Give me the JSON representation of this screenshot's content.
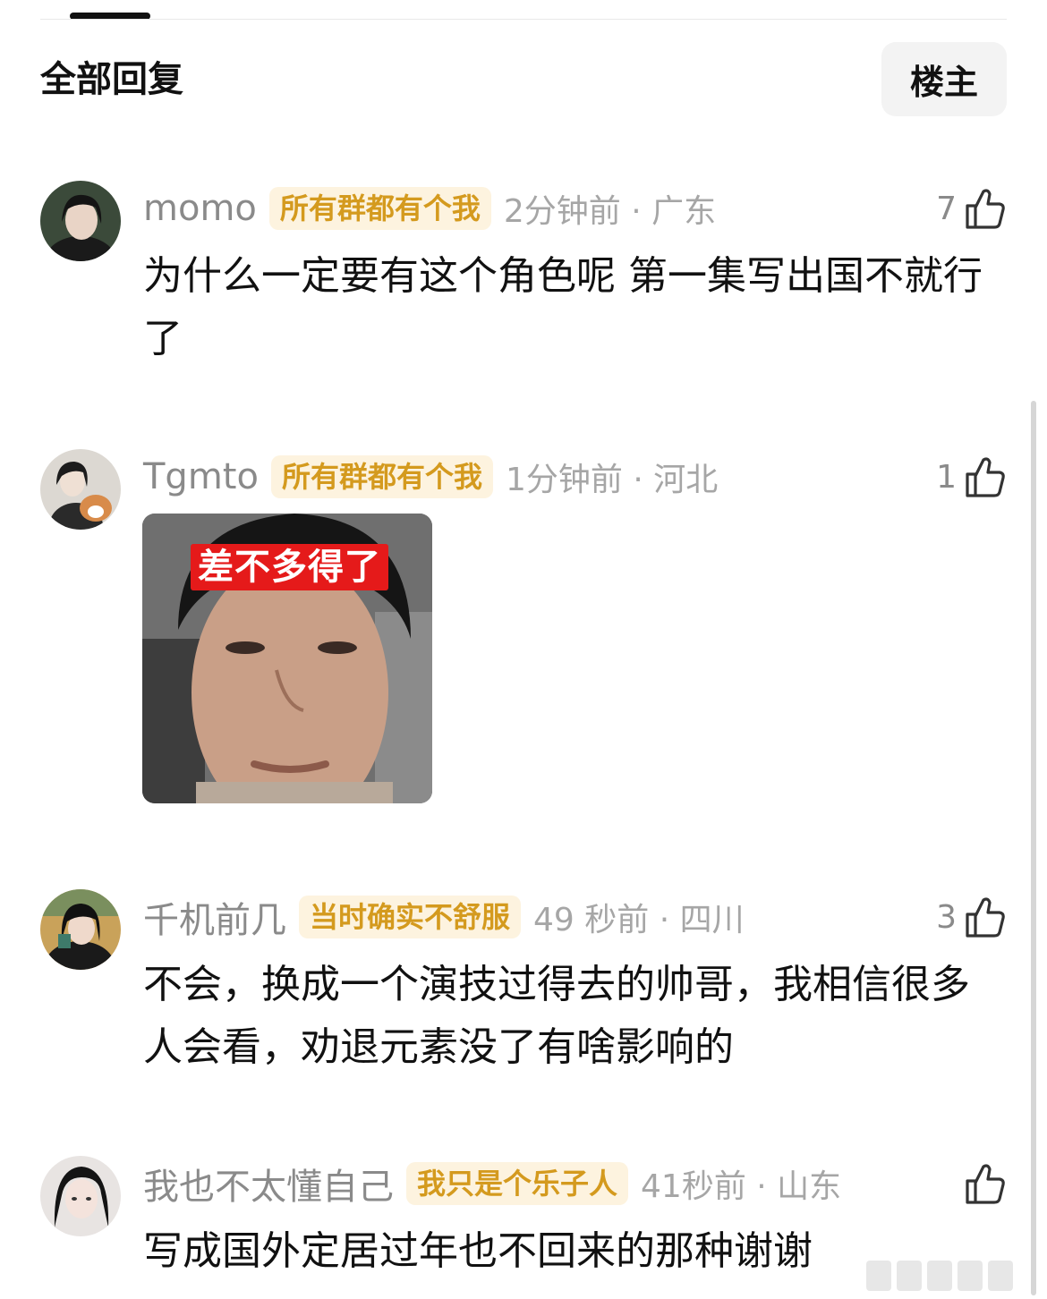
{
  "header": {
    "section_title": "全部回复",
    "op_filter_label": "楼主"
  },
  "comments": [
    {
      "username": "momo",
      "badge": "所有群都有个我",
      "time_location": "2分钟前 · 广东",
      "likes": "7",
      "text": "为什么一定要有这个角色呢 第一集写出国不就行了"
    },
    {
      "username": "Tgmto",
      "badge": "所有群都有个我",
      "time_location": "1分钟前 · 河北",
      "likes": "1",
      "sticker_caption": "差不多得了"
    },
    {
      "username": "千机前几",
      "badge": "当时确实不舒服",
      "time_location": "49 秒前 · 四川",
      "likes": "3",
      "text": "不会，换成一个演技过得去的帅哥，我相信很多人会看，劝退元素没了有啥影响的"
    },
    {
      "username": "我也不太懂自己",
      "badge": "我只是个乐子人",
      "time_location": "41秒前 · 山东",
      "likes": "",
      "text": "写成国外定居过年也不回来的那种谢谢"
    }
  ],
  "colors": {
    "badge_bg": "#fdf3df",
    "badge_text": "#d49a1e",
    "meta_text": "#a6a6a6",
    "sticker_caption_bg": "#e51a1a"
  },
  "icons": {
    "like": "thumbs-up-outline-icon"
  }
}
